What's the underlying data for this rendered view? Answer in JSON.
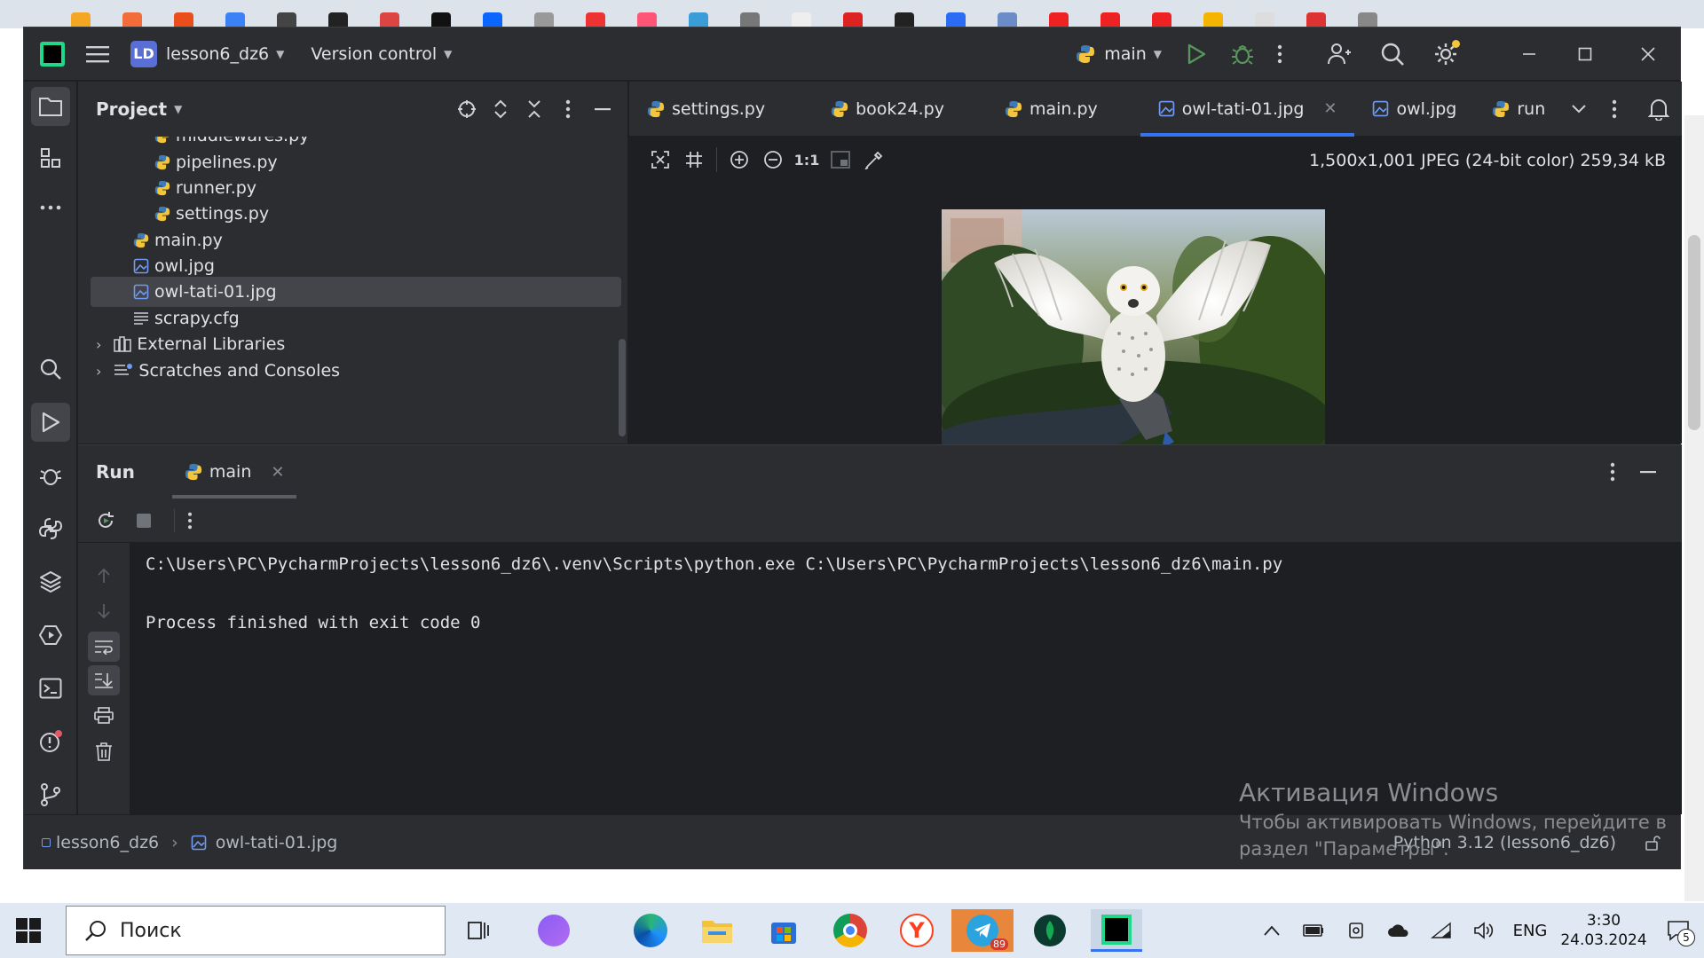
{
  "browser": {
    "tab_colors": [
      "#f5a623",
      "#f36d3b",
      "#e94e1b",
      "#3b82f6",
      "#444",
      "#222",
      "#d44",
      "#111",
      "#0a66ff",
      "#999",
      "#e33",
      "#f57",
      "#3b9dd8",
      "#777",
      "#eee",
      "#d22",
      "#222",
      "#2b6cf6",
      "#6b8cc7",
      "#e22",
      "#e22",
      "#e22",
      "#f5b400",
      "#ddd",
      "#d33",
      "#888"
    ]
  },
  "titlebar": {
    "project_initials": "LD",
    "project_name": "lesson6_dz6",
    "vcs_label": "Version control",
    "run_config": "main"
  },
  "project_panel": {
    "title": "Project",
    "items": [
      {
        "label": "middlewares.py",
        "type": "py",
        "indent": 2
      },
      {
        "label": "pipelines.py",
        "type": "py",
        "indent": 2
      },
      {
        "label": "runner.py",
        "type": "py",
        "indent": 2
      },
      {
        "label": "settings.py",
        "type": "py",
        "indent": 2
      },
      {
        "label": "main.py",
        "type": "py",
        "indent": 1
      },
      {
        "label": "owl.jpg",
        "type": "img",
        "indent": 1
      },
      {
        "label": "owl-tati-01.jpg",
        "type": "img",
        "indent": 1,
        "selected": true
      },
      {
        "label": "scrapy.cfg",
        "type": "cfg",
        "indent": 1
      },
      {
        "label": "External Libraries",
        "type": "lib",
        "indent": 0
      },
      {
        "label": "Scratches and Consoles",
        "type": "scratch",
        "indent": 0
      }
    ]
  },
  "editor": {
    "tabs": [
      {
        "label": "settings.py",
        "type": "py"
      },
      {
        "label": "book24.py",
        "type": "py"
      },
      {
        "label": "main.py",
        "type": "py"
      },
      {
        "label": "owl-tati-01.jpg",
        "type": "img",
        "active": true
      },
      {
        "label": "owl.jpg",
        "type": "img"
      },
      {
        "label": "run",
        "type": "py"
      }
    ],
    "zoom_label": "1:1",
    "image_info": "1,500x1,001 JPEG (24-bit color) 259,34 kB"
  },
  "run_panel": {
    "title": "Run",
    "tab_label": "main",
    "console_lines": [
      "C:\\Users\\PC\\PycharmProjects\\lesson6_dz6\\.venv\\Scripts\\python.exe C:\\Users\\PC\\PycharmProjects\\lesson6_dz6\\main.py",
      "",
      "Process finished with exit code 0"
    ]
  },
  "statusbar": {
    "crumb_project": "lesson6_dz6",
    "crumb_file": "owl-tati-01.jpg",
    "interpreter": "Python 3.12 (lesson6_dz6)"
  },
  "watermark": {
    "title": "Активация Windows",
    "line1": "Чтобы активировать Windows, перейдите в",
    "line2": "раздел \"Параметры\"."
  },
  "taskbar": {
    "search_placeholder": "Поиск",
    "telegram_badge": "89",
    "language": "ENG",
    "time": "3:30",
    "date": "24.03.2024",
    "notifications": "5"
  },
  "colors": {
    "accent": "#3574f0",
    "run_green": "#57965c",
    "python_blue": "#3d7ab8",
    "python_yellow": "#f2c53d"
  }
}
